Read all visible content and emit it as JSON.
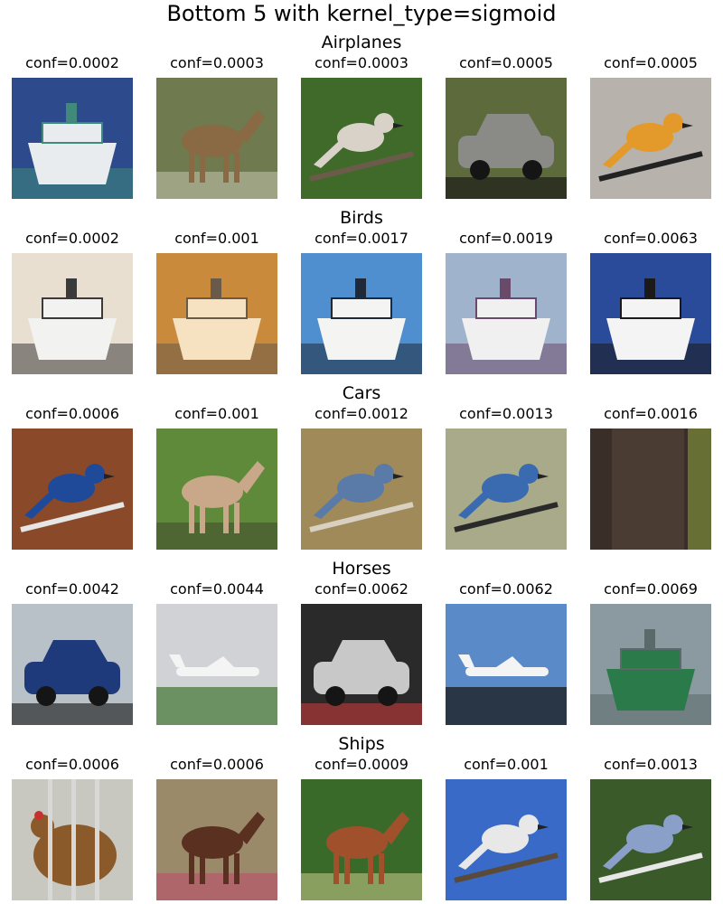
{
  "figure": {
    "title": "Bottom 5 with kernel_type=sigmoid"
  },
  "chart_data": {
    "type": "table",
    "title": "Bottom 5 with kernel_type=sigmoid",
    "rows": [
      {
        "label": "Airplanes",
        "items": [
          {
            "conf_label": "conf=0.0002",
            "conf": 0.0002,
            "subject": "ship-icon",
            "bg": "#2c4a8c",
            "fg": "#e8ecef",
            "accent": "#3f8a7a"
          },
          {
            "conf_label": "conf=0.0003",
            "conf": 0.0003,
            "subject": "horse-icon",
            "bg": "#6f7a4e",
            "fg": "#8a6a44",
            "accent": "#d8d4c8"
          },
          {
            "conf_label": "conf=0.0003",
            "conf": 0.0003,
            "subject": "bird-icon",
            "bg": "#3f6a2a",
            "fg": "#d8d2c8",
            "accent": "#6c5b4a"
          },
          {
            "conf_label": "conf=0.0005",
            "conf": 0.0005,
            "subject": "car-icon",
            "bg": "#5c6a3c",
            "fg": "#8a8a86",
            "accent": "#111111"
          },
          {
            "conf_label": "conf=0.0005",
            "conf": 0.0005,
            "subject": "bird-icon",
            "bg": "#b7b2ac",
            "fg": "#e39a2a",
            "accent": "#222222"
          }
        ]
      },
      {
        "label": "Birds",
        "items": [
          {
            "conf_label": "conf=0.0002",
            "conf": 0.0002,
            "subject": "ship-icon",
            "bg": "#e8dfd0",
            "fg": "#f2f2f0",
            "accent": "#3a3a3a"
          },
          {
            "conf_label": "conf=0.001",
            "conf": 0.001,
            "subject": "ship-icon",
            "bg": "#c98a3c",
            "fg": "#f6e2c0",
            "accent": "#6a5a4a"
          },
          {
            "conf_label": "conf=0.0017",
            "conf": 0.0017,
            "subject": "ship-icon",
            "bg": "#4f8fd0",
            "fg": "#f4f4f2",
            "accent": "#1f2a38"
          },
          {
            "conf_label": "conf=0.0019",
            "conf": 0.0019,
            "subject": "ship-icon",
            "bg": "#9fb4cc",
            "fg": "#f0f0f0",
            "accent": "#6a4a6a"
          },
          {
            "conf_label": "conf=0.0063",
            "conf": 0.0063,
            "subject": "ship-icon",
            "bg": "#2a4a9a",
            "fg": "#f4f4f4",
            "accent": "#1a1a1a"
          }
        ]
      },
      {
        "label": "Cars",
        "items": [
          {
            "conf_label": "conf=0.0006",
            "conf": 0.0006,
            "subject": "bird-icon",
            "bg": "#8a4a2a",
            "fg": "#1f4a9a",
            "accent": "#e6e6e6"
          },
          {
            "conf_label": "conf=0.001",
            "conf": 0.001,
            "subject": "horse-icon",
            "bg": "#5f8a3a",
            "fg": "#c8a888",
            "accent": "#3a3a2a"
          },
          {
            "conf_label": "conf=0.0012",
            "conf": 0.0012,
            "subject": "bird-icon",
            "bg": "#a08a5a",
            "fg": "#5a7aa8",
            "accent": "#d8d0c0"
          },
          {
            "conf_label": "conf=0.0013",
            "conf": 0.0013,
            "subject": "bird-icon",
            "bg": "#a8aa8a",
            "fg": "#3a6ab0",
            "accent": "#2a2a2a"
          },
          {
            "conf_label": "conf=0.0016",
            "conf": 0.0016,
            "subject": "tree-icon",
            "bg": "#3a2f28",
            "fg": "#4a3c32",
            "accent": "#7a8a3a"
          }
        ]
      },
      {
        "label": "Horses",
        "items": [
          {
            "conf_label": "conf=0.0042",
            "conf": 0.0042,
            "subject": "car-icon",
            "bg": "#b8c0c8",
            "fg": "#1f3a7a",
            "accent": "#111111"
          },
          {
            "conf_label": "conf=0.0044",
            "conf": 0.0044,
            "subject": "airplane-icon",
            "bg": "#d0d2d6",
            "fg": "#f4f4f4",
            "accent": "#4a7a3a"
          },
          {
            "conf_label": "conf=0.0062",
            "conf": 0.0062,
            "subject": "car-icon",
            "bg": "#2a2a2a",
            "fg": "#c8c8c8",
            "accent": "#c83a3a"
          },
          {
            "conf_label": "conf=0.0062",
            "conf": 0.0062,
            "subject": "airplane-icon",
            "bg": "#5a8ac8",
            "fg": "#f4f4f4",
            "accent": "#1a1a1a"
          },
          {
            "conf_label": "conf=0.0069",
            "conf": 0.0069,
            "subject": "ship-icon",
            "bg": "#8a9aa0",
            "fg": "#2a7a4a",
            "accent": "#5a6a6a"
          }
        ]
      },
      {
        "label": "Ships",
        "items": [
          {
            "conf_label": "conf=0.0006",
            "conf": 0.0006,
            "subject": "chicken-icon",
            "bg": "#c8c8c0",
            "fg": "#8a5a2a",
            "accent": "#d8d8d8"
          },
          {
            "conf_label": "conf=0.0006",
            "conf": 0.0006,
            "subject": "horse-icon",
            "bg": "#9a8a6a",
            "fg": "#5a3020",
            "accent": "#c83a6a"
          },
          {
            "conf_label": "conf=0.0009",
            "conf": 0.0009,
            "subject": "horse-icon",
            "bg": "#3a6a2a",
            "fg": "#a0502a",
            "accent": "#e8e0a0"
          },
          {
            "conf_label": "conf=0.001",
            "conf": 0.001,
            "subject": "bird-icon",
            "bg": "#3a6ac8",
            "fg": "#e8e8e8",
            "accent": "#5a4a3a"
          },
          {
            "conf_label": "conf=0.0013",
            "conf": 0.0013,
            "subject": "bird-icon",
            "bg": "#3a5a2a",
            "fg": "#8aa0c8",
            "accent": "#e8e8e8"
          }
        ]
      }
    ]
  }
}
